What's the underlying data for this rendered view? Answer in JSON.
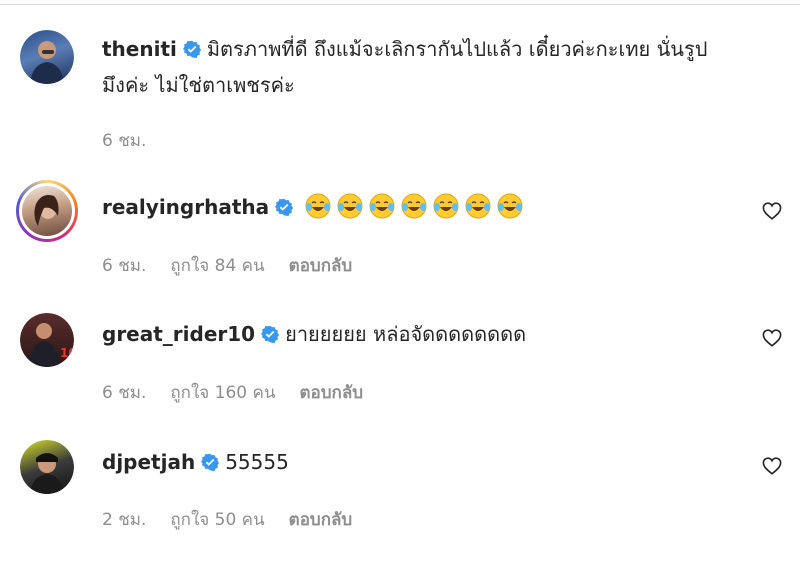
{
  "comments": [
    {
      "username": "theniti",
      "text_line1": "มิตรภาพที่ดี ถึงแม้จะเลิกรากันไปแล้ว เดี๋ยวค่ะกะเทย นั่นรูป",
      "text_line2": "มึงค่ะ ไม่ใช่ตาเพชรค่ะ",
      "time": "6 ชม.",
      "verified": true
    },
    {
      "username": "realyingrhatha",
      "emoji_count": 7,
      "emoji_name": "face-with-tears-of-joy",
      "time": "6 ชม.",
      "likes": "ถูกใจ 84 คน",
      "reply": "ตอบกลับ",
      "verified": true
    },
    {
      "username": "great_rider10",
      "text_line1": "ยายยยยย หล่อจัดดดดดดดด",
      "time": "6 ชม.",
      "likes": "ถูกใจ 160 คน",
      "reply": "ตอบกลับ",
      "verified": true
    },
    {
      "username": "djpetjah",
      "text_line1": "55555",
      "time": "2 ชม.",
      "likes": "ถูกใจ 50 คน",
      "reply": "ตอบกลับ",
      "verified": true
    }
  ],
  "colors": {
    "verified_blue": "#3897f0",
    "meta_gray": "#8e8e8e",
    "text": "#262626"
  }
}
